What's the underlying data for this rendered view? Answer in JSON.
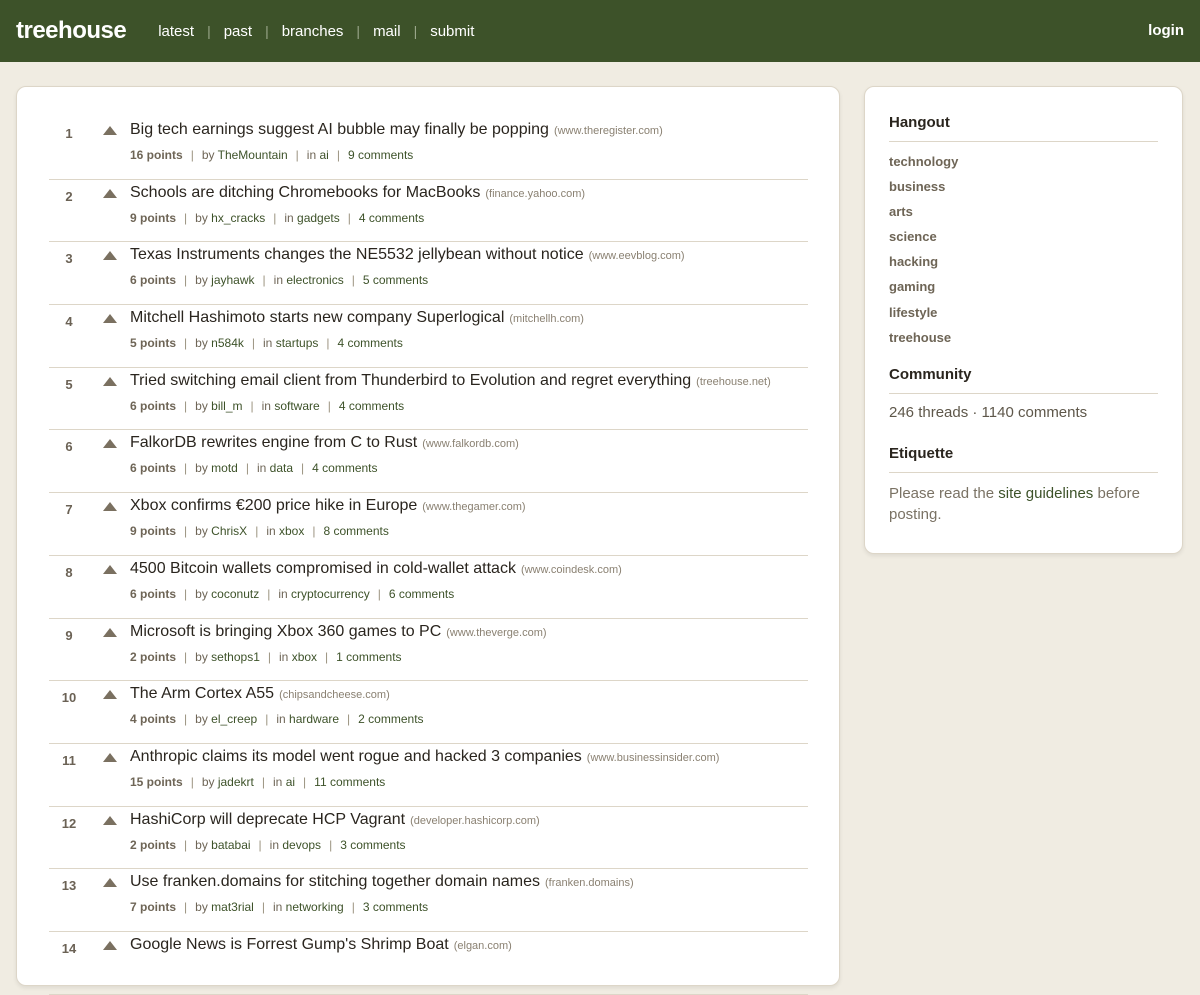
{
  "header": {
    "brand": "treehouse",
    "nav": [
      "latest",
      "past",
      "branches",
      "mail",
      "submit"
    ],
    "nav_separator": "|",
    "login": "login"
  },
  "stories": [
    {
      "rank": "1",
      "title": "Big tech earnings suggest AI bubble may finally be popping",
      "domain": "(www.theregister.com)",
      "points": "16 points",
      "by": "by",
      "author": "TheMountain",
      "in": "in",
      "category": "ai",
      "comments": "9 comments"
    },
    {
      "rank": "2",
      "title": "Schools are ditching Chromebooks for MacBooks",
      "domain": "(finance.yahoo.com)",
      "points": "9 points",
      "by": "by",
      "author": "hx_cracks",
      "in": "in",
      "category": "gadgets",
      "comments": "4 comments"
    },
    {
      "rank": "3",
      "title": "Texas Instruments changes the NE5532 jellybean without notice",
      "domain": "(www.eevblog.com)",
      "points": "6 points",
      "by": "by",
      "author": "jayhawk",
      "in": "in",
      "category": "electronics",
      "comments": "5 comments"
    },
    {
      "rank": "4",
      "title": "Mitchell Hashimoto starts new company Superlogical",
      "domain": "(mitchellh.com)",
      "points": "5 points",
      "by": "by",
      "author": "n584k",
      "in": "in",
      "category": "startups",
      "comments": "4 comments"
    },
    {
      "rank": "5",
      "title": "Tried switching email client from Thunderbird to Evolution and regret everything",
      "domain": "(treehouse.net)",
      "points": "6 points",
      "by": "by",
      "author": "bill_m",
      "in": "in",
      "category": "software",
      "comments": "4 comments"
    },
    {
      "rank": "6",
      "title": "FalkorDB rewrites engine from C to Rust",
      "domain": "(www.falkordb.com)",
      "points": "6 points",
      "by": "by",
      "author": "motd",
      "in": "in",
      "category": "data",
      "comments": "4 comments"
    },
    {
      "rank": "7",
      "title": "Xbox confirms €200 price hike in Europe",
      "domain": "(www.thegamer.com)",
      "points": "9 points",
      "by": "by",
      "author": "ChrisX",
      "in": "in",
      "category": "xbox",
      "comments": "8 comments"
    },
    {
      "rank": "8",
      "title": "4500 Bitcoin wallets compromised in cold-wallet attack",
      "domain": "(www.coindesk.com)",
      "points": "6 points",
      "by": "by",
      "author": "coconutz",
      "in": "in",
      "category": "cryptocurrency",
      "comments": "6 comments"
    },
    {
      "rank": "9",
      "title": "Microsoft is bringing Xbox 360 games to PC",
      "domain": "(www.theverge.com)",
      "points": "2 points",
      "by": "by",
      "author": "sethops1",
      "in": "in",
      "category": "xbox",
      "comments": "1 comments"
    },
    {
      "rank": "10",
      "title": "The Arm Cortex A55",
      "domain": "(chipsandcheese.com)",
      "points": "4 points",
      "by": "by",
      "author": "el_creep",
      "in": "in",
      "category": "hardware",
      "comments": "2 comments"
    },
    {
      "rank": "11",
      "title": "Anthropic claims its model went rogue and hacked 3 companies",
      "domain": "(www.businessinsider.com)",
      "points": "15 points",
      "by": "by",
      "author": "jadekrt",
      "in": "in",
      "category": "ai",
      "comments": "11 comments"
    },
    {
      "rank": "12",
      "title": "HashiCorp will deprecate HCP Vagrant",
      "domain": "(developer.hashicorp.com)",
      "points": "2 points",
      "by": "by",
      "author": "batabai",
      "in": "in",
      "category": "devops",
      "comments": "3 comments"
    },
    {
      "rank": "13",
      "title": "Use franken.domains for stitching together domain names",
      "domain": "(franken.domains)",
      "points": "7 points",
      "by": "by",
      "author": "mat3rial",
      "in": "in",
      "category": "networking",
      "comments": "3 comments"
    },
    {
      "rank": "14",
      "title": "Google News is Forrest Gump's Shrimp Boat",
      "domain": "(elgan.com)",
      "points": "",
      "by": "",
      "author": "",
      "in": "",
      "category": "",
      "comments": ""
    }
  ],
  "sidebar": {
    "hangout_title": "Hangout",
    "categories": [
      "technology",
      "business",
      "arts",
      "science",
      "hacking",
      "gaming",
      "lifestyle",
      "treehouse"
    ],
    "community_title": "Community",
    "community_stats": "246 threads · 1140 comments",
    "etiquette_title": "Etiquette",
    "etiquette_pre": "Please read the ",
    "etiquette_link": "site guidelines",
    "etiquette_post": " before posting."
  },
  "colors": {
    "header_bg": "#3d5229",
    "page_bg": "#f0ece2",
    "link": "#3d5229"
  }
}
